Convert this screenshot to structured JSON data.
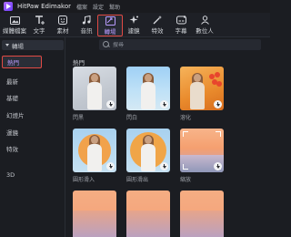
{
  "app": {
    "title": "HitPaw Edimakor",
    "menu": [
      "檔案",
      "設定",
      "幫助"
    ]
  },
  "toolbar": {
    "items": [
      {
        "label": "媒體檔案",
        "icon": "media-icon"
      },
      {
        "label": "文字",
        "icon": "text-icon"
      },
      {
        "label": "素材",
        "icon": "stickers-icon"
      },
      {
        "label": "音訊",
        "icon": "audio-icon"
      },
      {
        "label": "轉場",
        "icon": "transition-icon",
        "active": true
      },
      {
        "label": "濾鏡",
        "icon": "filter-icon"
      },
      {
        "label": "特效",
        "icon": "effects-icon"
      },
      {
        "label": "字幕",
        "icon": "subtitle-icon"
      },
      {
        "label": "數位人",
        "icon": "avatar-icon"
      }
    ],
    "accent": "#b99cff",
    "highlight": "#e14a44"
  },
  "search": {
    "placeholder": "搜尋"
  },
  "sidebar": {
    "header": "轉場",
    "items": [
      "熱門",
      "最新",
      "基礎",
      "幻燈片",
      "運鏡",
      "特效",
      "3D"
    ],
    "selected": "熱門"
  },
  "content": {
    "section_title": "熱門",
    "thumbnails": [
      {
        "caption": "閃黑"
      },
      {
        "caption": "閃白"
      },
      {
        "caption": "溶化"
      },
      {
        "caption": "圓形滑入"
      },
      {
        "caption": "圓形滑出"
      },
      {
        "caption": "縮放"
      },
      {
        "caption": ""
      },
      {
        "caption": ""
      },
      {
        "caption": ""
      }
    ]
  }
}
